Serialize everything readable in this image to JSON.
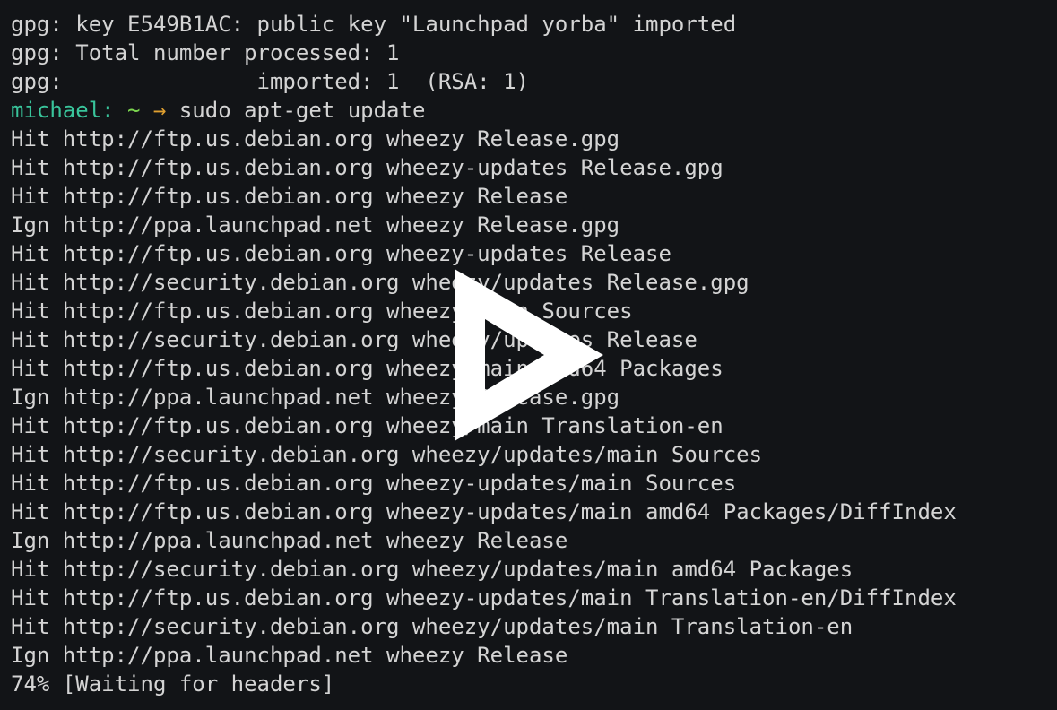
{
  "terminal": {
    "lines_before_prompt": [
      "gpg: key E549B1AC: public key \"Launchpad yorba\" imported",
      "gpg: Total number processed: 1",
      "gpg:               imported: 1  (RSA: 1)"
    ],
    "prompt": {
      "user": "michael:",
      "dir": "~",
      "arrow": "→",
      "command": "sudo apt-get update"
    },
    "output_lines": [
      "Hit http://ftp.us.debian.org wheezy Release.gpg",
      "Hit http://ftp.us.debian.org wheezy-updates Release.gpg",
      "Hit http://ftp.us.debian.org wheezy Release",
      "Ign http://ppa.launchpad.net wheezy Release.gpg",
      "Hit http://ftp.us.debian.org wheezy-updates Release",
      "Hit http://security.debian.org wheezy/updates Release.gpg",
      "Hit http://ftp.us.debian.org wheezy/main Sources",
      "Hit http://security.debian.org wheezy/updates Release",
      "Hit http://ftp.us.debian.org wheezy/main amd64 Packages",
      "Ign http://ppa.launchpad.net wheezy Release.gpg",
      "Hit http://ftp.us.debian.org wheezy/main Translation-en",
      "Hit http://security.debian.org wheezy/updates/main Sources",
      "Hit http://ftp.us.debian.org wheezy-updates/main Sources",
      "Hit http://ftp.us.debian.org wheezy-updates/main amd64 Packages/DiffIndex",
      "Ign http://ppa.launchpad.net wheezy Release",
      "Hit http://security.debian.org wheezy/updates/main amd64 Packages",
      "Hit http://ftp.us.debian.org wheezy-updates/main Translation-en/DiffIndex",
      "Hit http://security.debian.org wheezy/updates/main Translation-en",
      "Ign http://ppa.launchpad.net wheezy Release",
      "74% [Waiting for headers]"
    ]
  },
  "overlay": {
    "icon": "play-icon",
    "color": "#ffffff"
  },
  "colors": {
    "background": "#121417",
    "text": "#d4d4d4",
    "prompt_user": "#39c49b",
    "prompt_dir": "#7bd54f",
    "prompt_arrow": "#e0a030"
  }
}
